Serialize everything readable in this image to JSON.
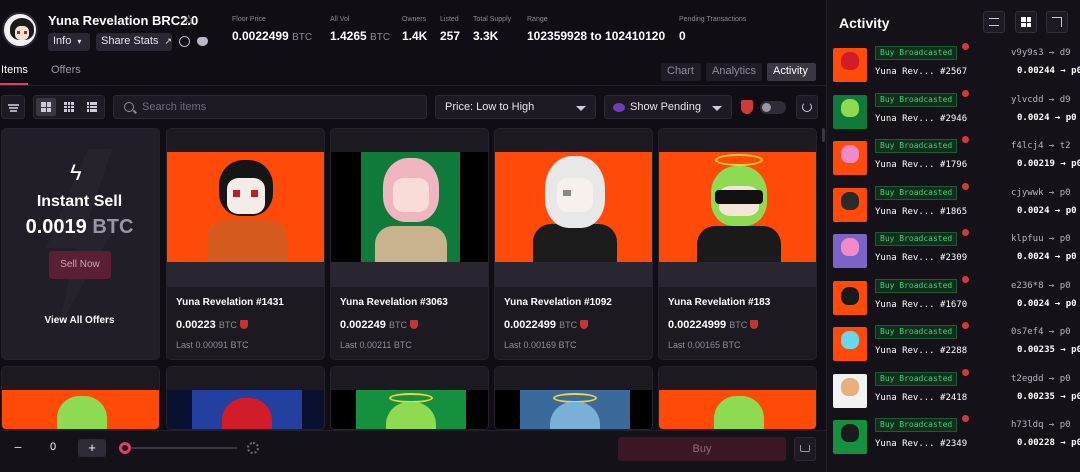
{
  "header": {
    "collection_name": "Yuna Revelation BRC2.0",
    "info_label": "Info",
    "share_label": "Share Stats",
    "stats": [
      {
        "label": "Floor Price",
        "value": "0.0022499",
        "currency": "BTC"
      },
      {
        "label": "All Vol",
        "value": "1.4265",
        "currency": "BTC"
      },
      {
        "label": "Owners",
        "value": "1.4K",
        "currency": ""
      },
      {
        "label": "Listed",
        "value": "257",
        "currency": ""
      },
      {
        "label": "Total Supply",
        "value": "3.3K",
        "currency": ""
      },
      {
        "label": "Range",
        "value": "102359928 to 102410120",
        "currency": ""
      },
      {
        "label": "Pending Transactions",
        "value": "0",
        "currency": ""
      }
    ]
  },
  "tabs": {
    "items": "Items",
    "offers": "Offers"
  },
  "view_buttons": {
    "chart": "Chart",
    "analytics": "Analytics",
    "activity": "Activity"
  },
  "toolbar": {
    "search_placeholder": "Search items",
    "sort_value": "Price: Low to High",
    "pending_value": "Show Pending"
  },
  "instant_sell": {
    "title": "Instant Sell",
    "price": "0.0019",
    "currency": "BTC",
    "button": "Sell Now",
    "view_all": "View All Offers"
  },
  "nfts": [
    {
      "name": "Yuna Revelation #1431",
      "price": "0.00223",
      "currency": "BTC",
      "last": "Last 0.00091 BTC",
      "bg": "#ff4a0a"
    },
    {
      "name": "Yuna Revelation #3063",
      "price": "0.002249",
      "currency": "BTC",
      "last": "Last 0.00211 BTC",
      "bg": "#0f7a3a"
    },
    {
      "name": "Yuna Revelation #1092",
      "price": "0.0022499",
      "currency": "BTC",
      "last": "Last 0.00169 BTC",
      "bg": "#ff4a0a"
    },
    {
      "name": "Yuna Revelation #183",
      "price": "0.00224999",
      "currency": "BTC",
      "last": "Last 0.00165 BTC",
      "bg": "#ff4a0a"
    }
  ],
  "bottom_bar": {
    "minus": "−",
    "quantity": "0",
    "plus": "+",
    "buy_label": "Buy"
  },
  "activity": {
    "title": "Activity",
    "rows": [
      {
        "badge": "Buy Broadcasted",
        "name": "Yuna Rev... #2567",
        "addr": "v9y9s3 → d9",
        "price": "0.00244 → p0"
      },
      {
        "badge": "Buy Broadcasted",
        "name": "Yuna Rev... #2946",
        "addr": "ylvcdd → d9",
        "price": "0.0024 → p0"
      },
      {
        "badge": "Buy Broadcasted",
        "name": "Yuna Rev... #1796",
        "addr": "f4lcj4 → t2",
        "price": "0.00219 → p0"
      },
      {
        "badge": "Buy Broadcasted",
        "name": "Yuna Rev... #1865",
        "addr": "cjywwk → p0",
        "price": "0.0024 → p0"
      },
      {
        "badge": "Buy Broadcasted",
        "name": "Yuna Rev... #2309",
        "addr": "klpfuu → p0",
        "price": "0.0024 → p0"
      },
      {
        "badge": "Buy Broadcasted",
        "name": "Yuna Rev... #1670",
        "addr": "e236*8 → p0",
        "price": "0.0024 → p0"
      },
      {
        "badge": "Buy Broadcasted",
        "name": "Yuna Rev... #2288",
        "addr": "0s7ef4 → p0",
        "price": "0.00235 → p0"
      },
      {
        "badge": "Buy Broadcasted",
        "name": "Yuna Rev... #2418",
        "addr": "t2egdd → p0",
        "price": "0.00235 → p0"
      },
      {
        "badge": "Buy Broadcasted",
        "name": "Yuna Rev... #2349",
        "addr": "h73ldq → p0",
        "price": "0.00228 → p0"
      }
    ]
  },
  "colors": {
    "accent": "#e23a6a",
    "nft_orange": "#ff4a0a",
    "badge_green": "#3fd07a",
    "background": "#100d14"
  }
}
